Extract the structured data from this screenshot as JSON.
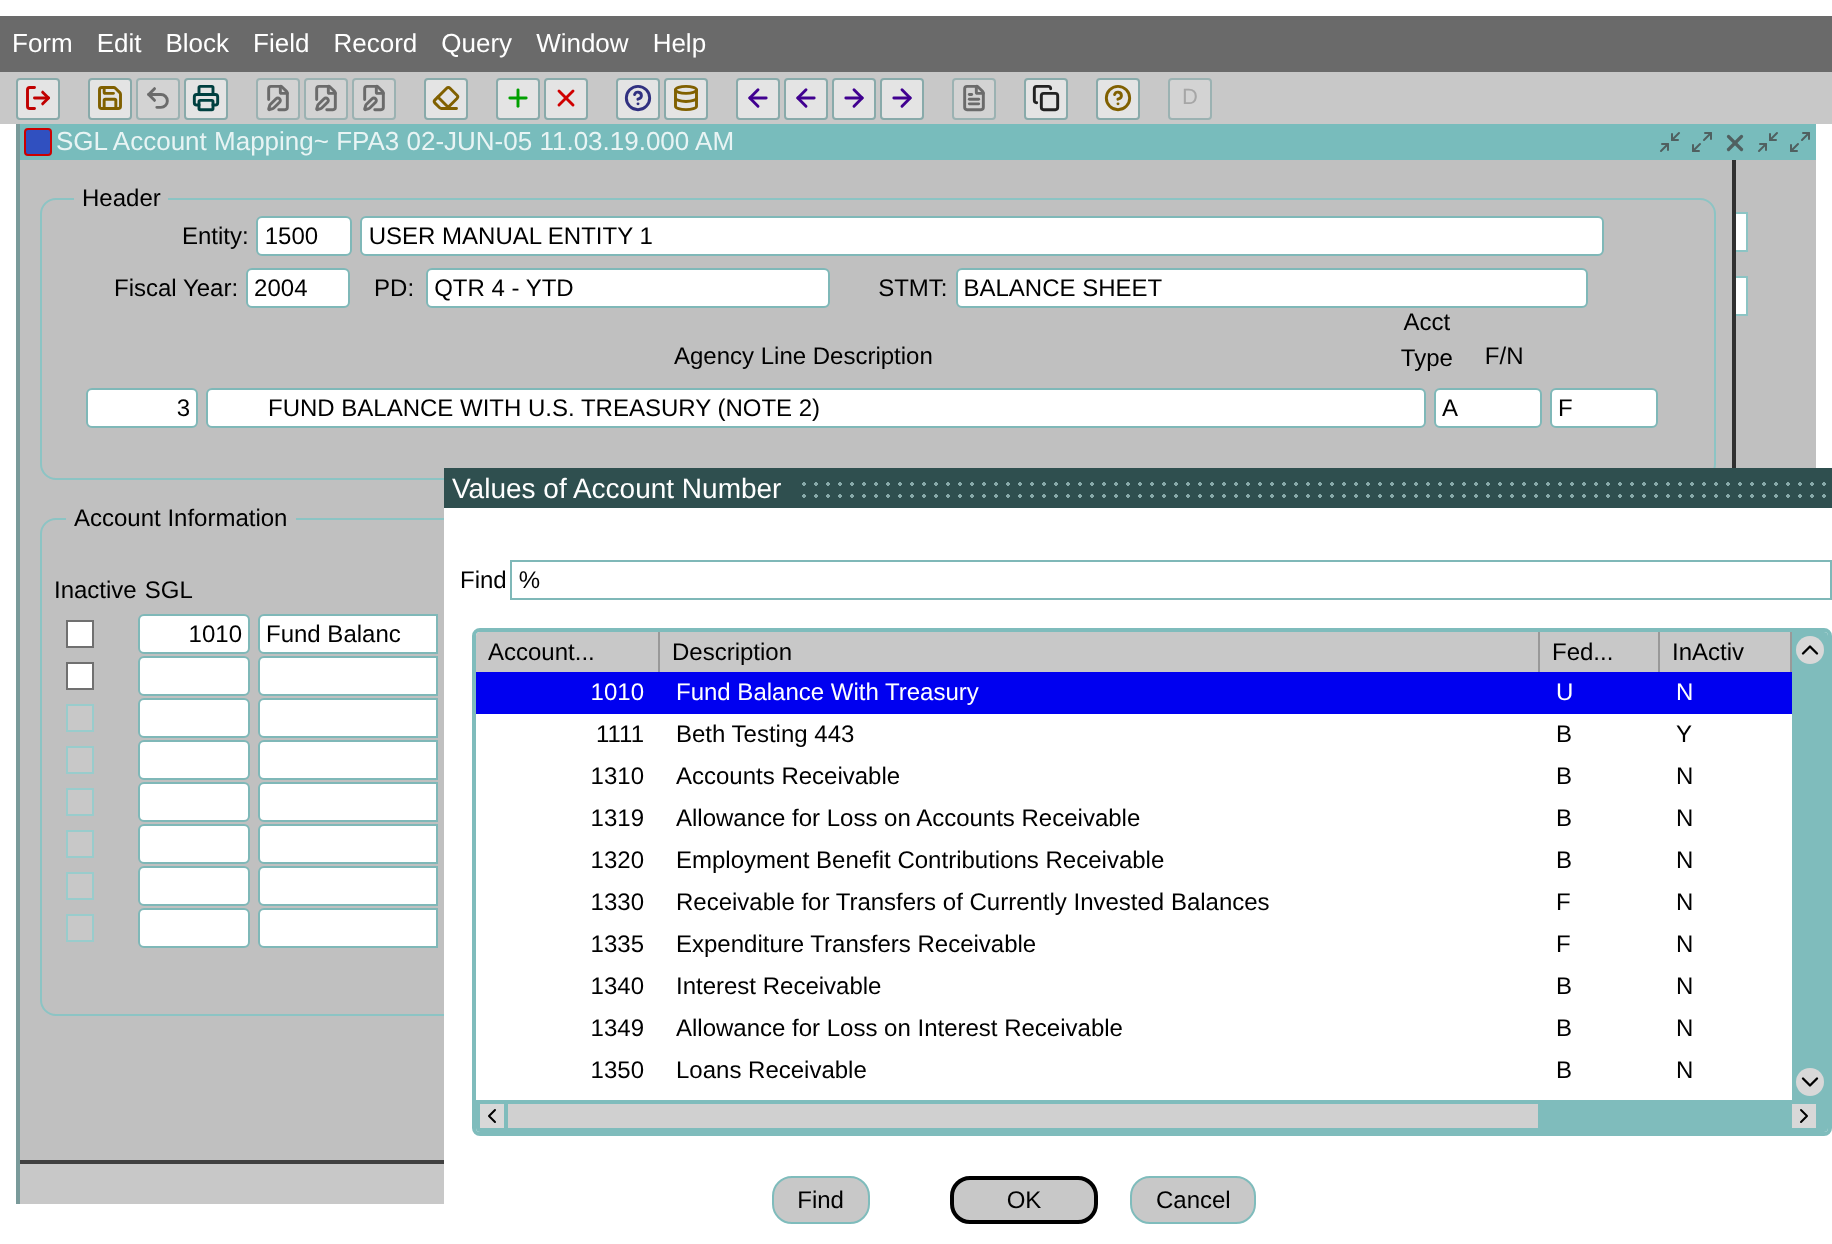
{
  "menu": [
    "Form",
    "Edit",
    "Block",
    "Field",
    "Record",
    "Query",
    "Window",
    "Help"
  ],
  "toolbar": [
    [
      {
        "disabled": false
      }
    ],
    [
      {
        "disabled": false
      },
      {
        "disabled": true
      },
      {
        "disabled": false
      }
    ],
    [
      {
        "disabled": true
      },
      {
        "disabled": true
      },
      {
        "disabled": true
      }
    ],
    [
      {
        "disabled": false
      }
    ],
    [
      {
        "disabled": false
      },
      {
        "disabled": false
      }
    ],
    [
      {
        "disabled": false
      },
      {
        "disabled": false
      }
    ],
    [
      {
        "disabled": false
      },
      {
        "disabled": false
      },
      {
        "disabled": false
      },
      {
        "disabled": false
      }
    ],
    [
      {
        "disabled": true
      }
    ],
    [
      {
        "disabled": false
      }
    ],
    [
      {
        "disabled": false
      }
    ],
    [
      {
        "disabled": true,
        "label": "D"
      }
    ]
  ],
  "window": {
    "title": "SGL Account Mapping~  FPA3  02-JUN-05 11.03.19.000 AM"
  },
  "header": {
    "title": "Header",
    "entity_label": "Entity:",
    "entity": "1500",
    "entity_name": "USER MANUAL ENTITY 1",
    "fiscal_year_label": "Fiscal Year:",
    "fiscal_year": "2004",
    "pd_label": "PD:",
    "pd": "QTR 4 - YTD",
    "stmt_label": "STMT:",
    "stmt": "BALANCE SHEET",
    "col_description": "Agency Line Description",
    "col_acct_type_1": "Acct",
    "col_acct_type_2": "Type",
    "col_fn": "F/N",
    "line": "3",
    "description": "FUND BALANCE WITH U.S. TREASURY (NOTE 2)",
    "acct_type": "A",
    "fn": "F"
  },
  "account_info": {
    "title": "Account Information",
    "col_inactive": "Inactive",
    "col_sgl": "SGL",
    "rows": [
      {
        "disabled": false,
        "checked": false,
        "sgl": "1010",
        "description": "Fund Balanc"
      },
      {
        "disabled": false,
        "checked": false
      },
      {
        "disabled": true,
        "checked": false
      },
      {
        "disabled": true,
        "checked": false
      },
      {
        "disabled": true,
        "checked": false
      },
      {
        "disabled": true,
        "checked": false
      },
      {
        "disabled": true,
        "checked": false
      },
      {
        "disabled": true,
        "checked": false
      }
    ]
  },
  "dialog": {
    "title": "Values of Account Number",
    "find_label": "Find",
    "find_value": "%",
    "columns": [
      "Account...",
      "Description",
      "Fed...",
      "InActiv"
    ],
    "rows": [
      {
        "selected": true,
        "cells": [
          "1010",
          "Fund Balance With Treasury",
          "U",
          "N"
        ]
      },
      {
        "selected": false,
        "cells": [
          "1111",
          "Beth Testing 443",
          "B",
          "Y"
        ]
      },
      {
        "selected": false,
        "cells": [
          "1310",
          "Accounts Receivable",
          "B",
          "N"
        ]
      },
      {
        "selected": false,
        "cells": [
          "1319",
          "Allowance for Loss on Accounts Receivable",
          "B",
          "N"
        ]
      },
      {
        "selected": false,
        "cells": [
          "1320",
          "Employment Benefit Contributions Receivable",
          "B",
          "N"
        ]
      },
      {
        "selected": false,
        "cells": [
          "1330",
          "Receivable for Transfers of Currently Invested Balances",
          "F",
          "N"
        ]
      },
      {
        "selected": false,
        "cells": [
          "1335",
          "Expenditure Transfers Receivable",
          "F",
          "N"
        ]
      },
      {
        "selected": false,
        "cells": [
          "1340",
          "Interest Receivable",
          "B",
          "N"
        ]
      },
      {
        "selected": false,
        "cells": [
          "1349",
          "Allowance for Loss on Interest Receivable",
          "B",
          "N"
        ]
      },
      {
        "selected": false,
        "cells": [
          "1350",
          "Loans Receivable",
          "B",
          "N"
        ]
      }
    ],
    "buttons": [
      {
        "label": "Find",
        "default": false
      },
      {
        "label": "OK",
        "default": true
      },
      {
        "label": "Cancel",
        "default": false
      }
    ]
  }
}
